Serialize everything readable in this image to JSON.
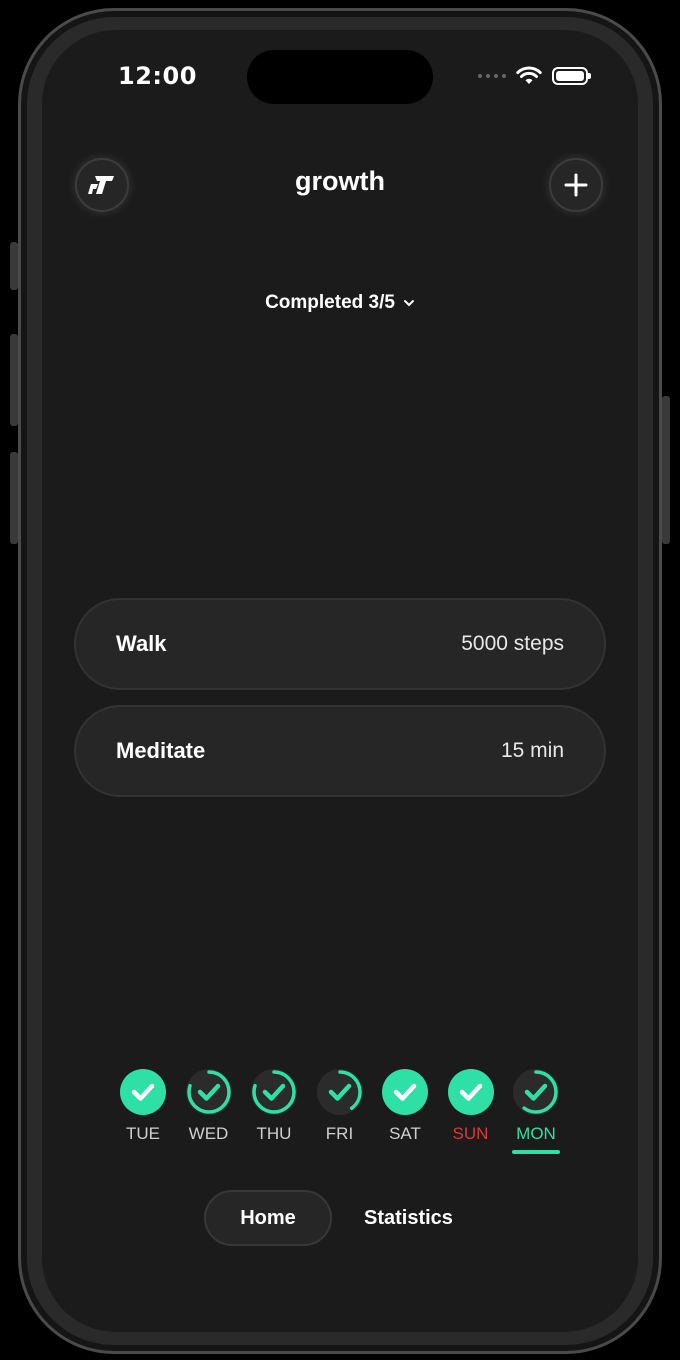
{
  "status_bar": {
    "time": "12:00"
  },
  "header": {
    "title": "growth",
    "logo_icon": "growth-logo-icon",
    "add_icon": "plus-icon"
  },
  "summary": {
    "completed_label": "Completed 3/5",
    "chevron_icon": "chevron-down-icon"
  },
  "tasks": [
    {
      "name": "Walk",
      "value": "5000 steps"
    },
    {
      "name": "Meditate",
      "value": "15 min"
    }
  ],
  "week": [
    {
      "label": "TUE",
      "state": "complete",
      "progress": 1.0
    },
    {
      "label": "WED",
      "state": "partial",
      "progress": 0.8
    },
    {
      "label": "THU",
      "state": "partial",
      "progress": 0.8
    },
    {
      "label": "FRI",
      "state": "partial",
      "progress": 0.4
    },
    {
      "label": "SAT",
      "state": "complete",
      "progress": 1.0
    },
    {
      "label": "SUN",
      "state": "complete",
      "progress": 1.0
    },
    {
      "label": "MON",
      "state": "partial",
      "progress": 0.6,
      "selected": true
    }
  ],
  "nav": {
    "home": "Home",
    "statistics": "Statistics"
  },
  "colors": {
    "accent": "#2ee0a6",
    "sunday": "#d93a35",
    "background": "#1b1b1b",
    "card": "#262626"
  }
}
